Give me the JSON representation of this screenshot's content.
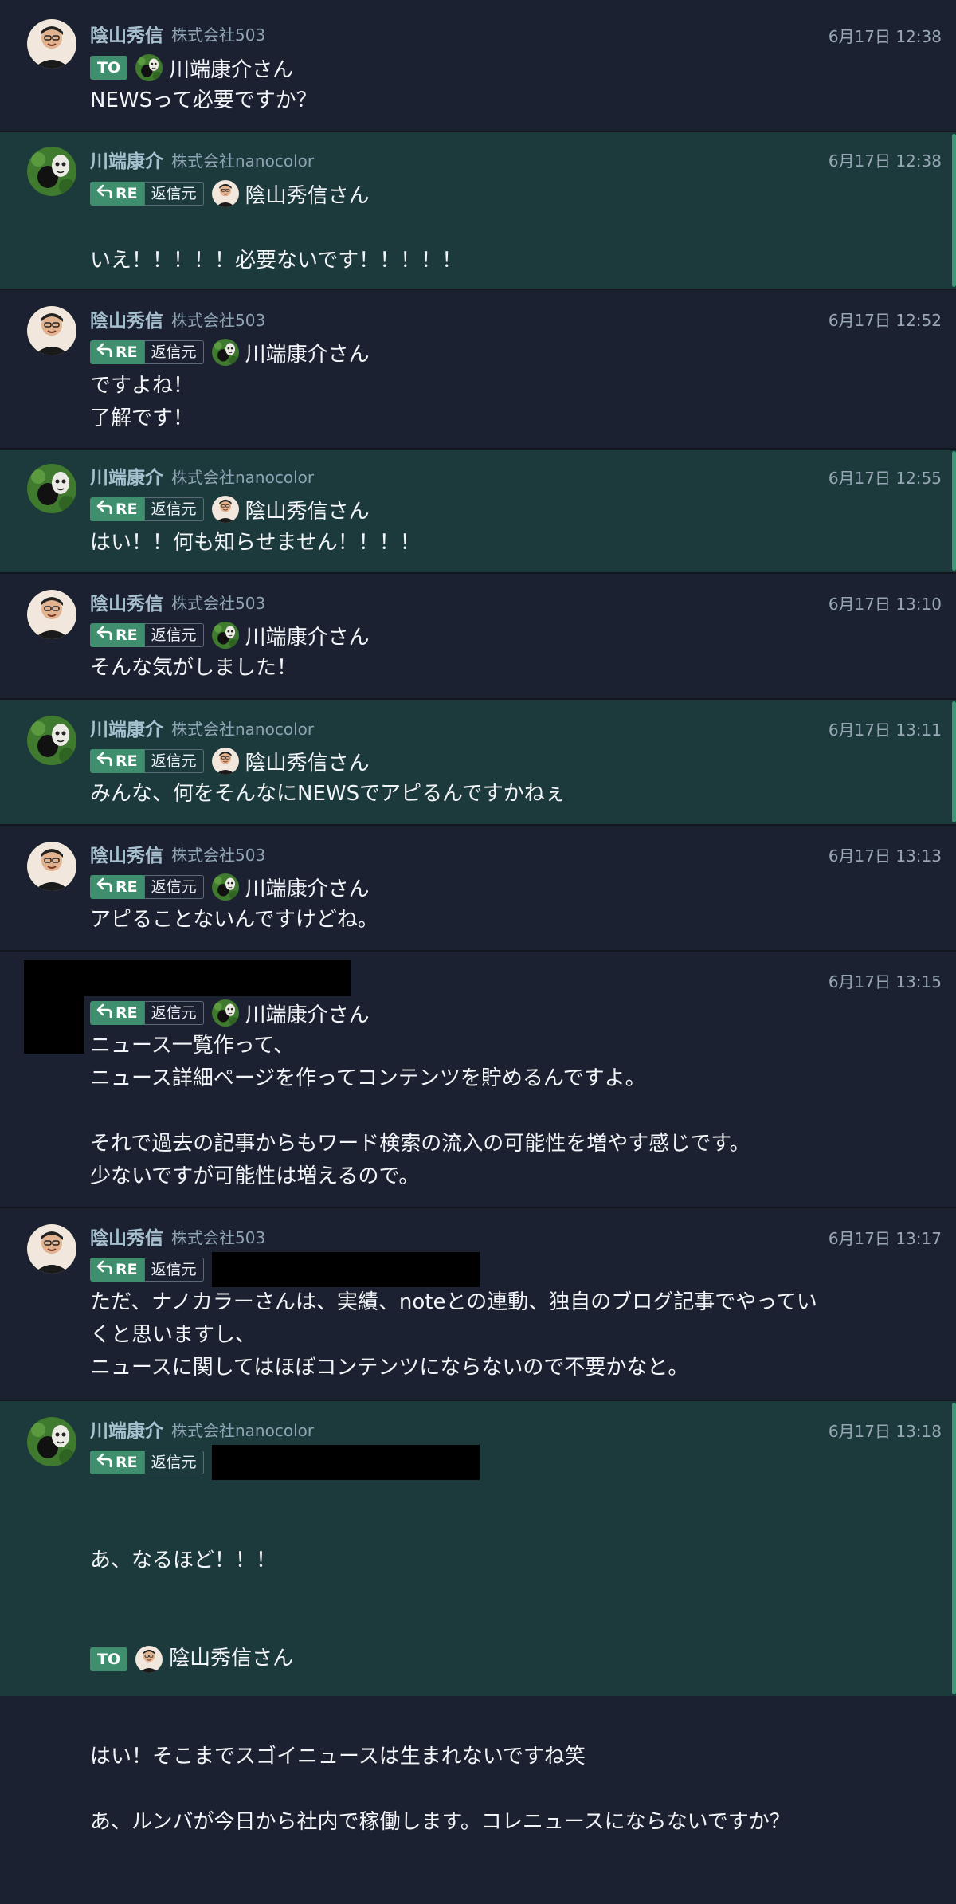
{
  "users": {
    "kageyama": {
      "name": "陰山秀信",
      "org": "株式会社503"
    },
    "kawabata": {
      "name": "川端康介",
      "org": "株式会社nanocolor"
    }
  },
  "labels": {
    "to": "TO",
    "re": "RE",
    "reply_source": "返信元"
  },
  "colors": {
    "background": "#1b2130",
    "highlight": "#1c3a3c",
    "accent": "#3f8f6f",
    "bar": "#3f9878"
  },
  "messages": [
    {
      "time": "6月17日 12:38",
      "tag_label": "TO",
      "target": "川端康介さん",
      "text": "NEWSって必要ですか？"
    },
    {
      "time": "6月17日 12:38",
      "target": "陰山秀信さん",
      "text": "\nいえ！！！！！必要ないです！！！！！"
    },
    {
      "time": "6月17日 12:52",
      "target": "川端康介さん",
      "text": "ですよね！\n了解です！"
    },
    {
      "time": "6月17日 12:55",
      "target": "陰山秀信さん",
      "text": "はい！！何も知らせません！！！！"
    },
    {
      "time": "6月17日 13:10",
      "target": "川端康介さん",
      "text": "そんな気がしました！"
    },
    {
      "time": "6月17日 13:11",
      "target": "陰山秀信さん",
      "text": "みんな、何をそんなにNEWSでアピるんですかねぇ"
    },
    {
      "time": "6月17日 13:13",
      "target": "川端康介さん",
      "text": "アピることないんですけどね。"
    },
    {
      "time": "6月17日 13:15",
      "target": "川端康介さん",
      "text": "ニュース一覧作って、\nニュース詳細ページを作ってコンテンツを貯めるんですよ。\n\nそれで過去の記事からもワード検索の流入の可能性を増やす感じです。\n少ないですが可能性は増えるので。"
    },
    {
      "time": "6月17日 13:17",
      "text": "ただ、ナノカラーさんは、実績、noteとの連動、独自のブログ記事でやってい\nくと思いますし、\nニュースに関してはほぼコンテンツにならないので不要かなと。"
    },
    {
      "time": "6月17日 13:18",
      "text_before": "あ、なるほど！！！\n",
      "inline_to": "陰山秀信さん",
      "text_after": "はい！そこまでスゴイニュースは生まれないですね笑\n\nあ、ルンバが今日から社内で稼働します。コレニュースにならないですか？"
    }
  ]
}
